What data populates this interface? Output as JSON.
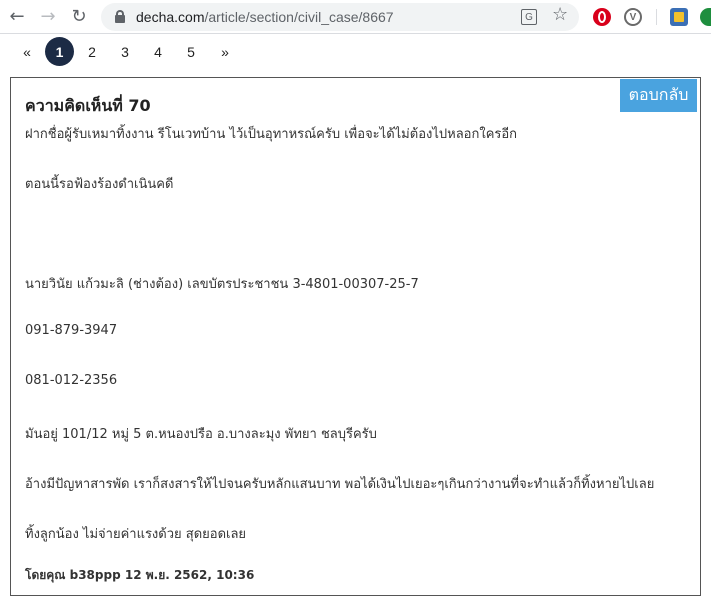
{
  "browser": {
    "url_host": "decha.com",
    "url_path": "/article/section/civil_case/8667",
    "translate_glyph": "G",
    "icons": {
      "back": "back-arrow-icon",
      "forward": "forward-arrow-icon",
      "reload": "reload-icon",
      "lock": "lock-icon",
      "translate": "translate-icon",
      "star": "bookmark-star-icon"
    },
    "extensions": [
      "opera-icon",
      "v-extension-icon",
      "app-extension-icon",
      "green-extension-icon"
    ]
  },
  "pagination": {
    "prev": "«",
    "pages": [
      "1",
      "2",
      "3",
      "4",
      "5"
    ],
    "next": "»",
    "current": "1"
  },
  "comment": {
    "title": "ความคิดเห็นที่ 70",
    "reply_label": "ตอบกลับ",
    "lines": [
      "ฝากชื่อผู้รับเหมาทิ้งงาน รีโนเวทบ้าน ไว้เป็นอุทาหรณ์ครับ เพื่อจะได้ไม่ต้องไปหลอกใครอีก",
      "ตอนนี้รอฟ้องร้องดำเนินคดี",
      "นายวินัย  แก้วมะลิ (ช่างต้อง)  เลขบัตรประชาชน 3-4801-00307-25-7",
      "091-879-3947",
      "081-012-2356",
      "มันอยู่ 101/12 หมู่ 5 ต.หนองปรือ อ.บางละมุง   พัทยา ชลบุรีครับ",
      "อ้างมีปัญหาสารพัด เราก็สงสารให้ไปจนครับหลักแสนบาท พอได้เงินไปเยอะๆเกินกว่างานที่จะทำแล้วก็ทิ้งหายไปเลย",
      "ทิ้งลูกน้อง ไม่จ่ายค่าแรงด้วย สุดยอดเลย"
    ],
    "byline": "โดยคุณ b38ppp 12 พ.ย. 2562, 10:36"
  },
  "colors": {
    "accent": "#4aa3df",
    "active_page": "#1c2b45"
  }
}
